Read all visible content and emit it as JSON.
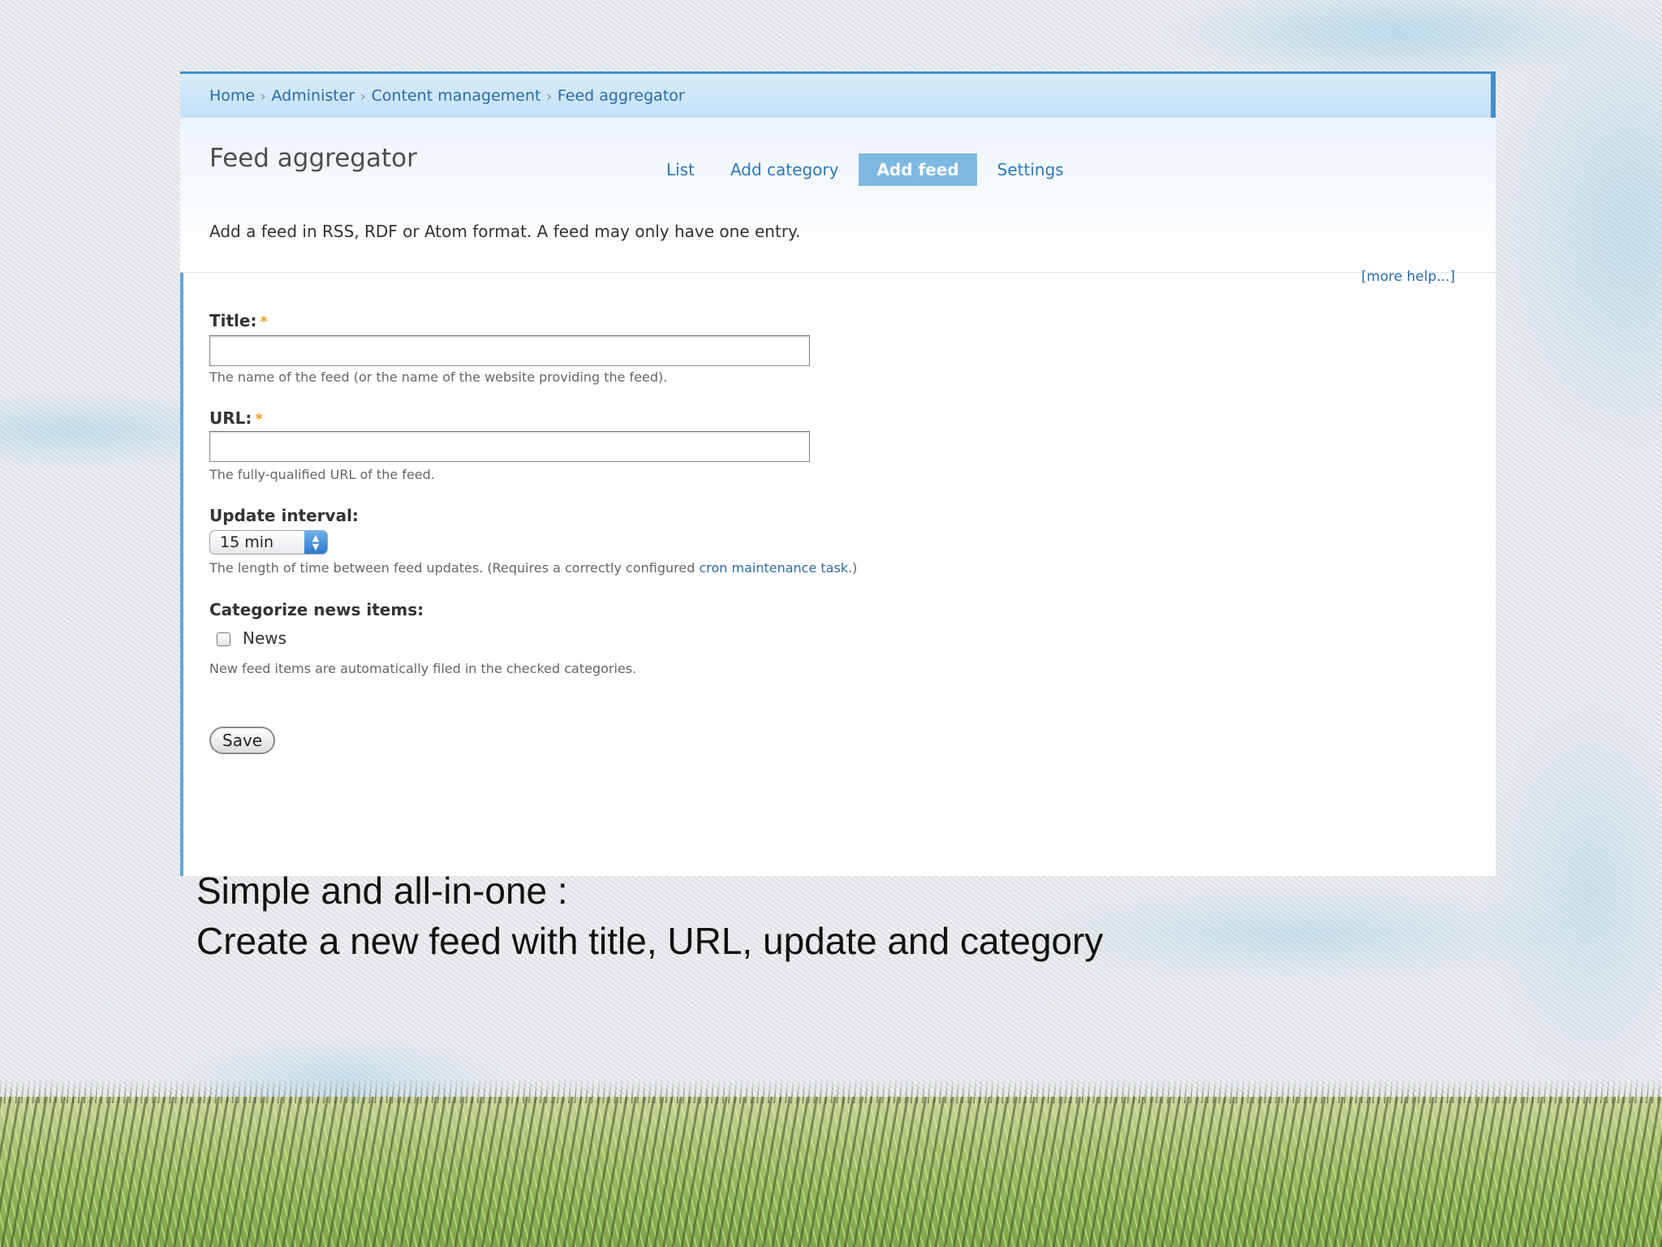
{
  "breadcrumb": {
    "items": [
      "Home",
      "Administer",
      "Content management",
      "Feed aggregator"
    ],
    "separator": "›"
  },
  "page": {
    "title": "Feed aggregator",
    "intro": "Add a feed in RSS, RDF or Atom format. A feed may only have one entry.",
    "more_help": "[more help...]"
  },
  "tabs": [
    {
      "label": "List",
      "active": false
    },
    {
      "label": "Add category",
      "active": false
    },
    {
      "label": "Add feed",
      "active": true
    },
    {
      "label": "Settings",
      "active": false
    }
  ],
  "form": {
    "title": {
      "label": "Title:",
      "required_mark": "*",
      "value": "",
      "description": "The name of the feed (or the name of the website providing the feed)."
    },
    "url": {
      "label": "URL:",
      "required_mark": "*",
      "value": "",
      "description": "The fully-qualified URL of the feed."
    },
    "update_interval": {
      "label": "Update interval:",
      "selected": "15 min",
      "description_prefix": "The length of time between feed updates. (Requires a correctly configured ",
      "description_link": "cron maintenance task",
      "description_suffix": ".)"
    },
    "categorize": {
      "label": "Categorize news items:",
      "options": [
        {
          "label": "News",
          "checked": false
        }
      ],
      "description": "New feed items are automatically filed in the checked categories."
    },
    "save_label": "Save"
  },
  "caption": {
    "line1": "Simple and all-in-one :",
    "line2": "Create a new feed with title, URL,  update and  category"
  },
  "colors": {
    "link": "#2c6aa8",
    "active_tab": "#7db9e2",
    "required": "#f0a020",
    "breadcrumb_bar": "#c4e1f5"
  }
}
